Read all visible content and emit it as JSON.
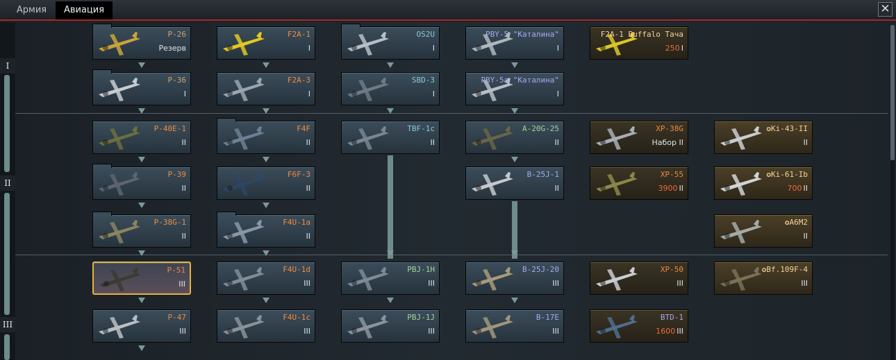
{
  "tabs": {
    "army": "Армия",
    "aviation": "Авиация"
  },
  "close_label": "✕",
  "ranks": [
    "I",
    "II",
    "III"
  ],
  "vehicles": [
    {
      "id": "p26",
      "name": "P-26",
      "stat": "Резерв",
      "cls": "sq"
    },
    {
      "id": "p36",
      "name": "P-36",
      "stat": "I",
      "cls": "sq"
    },
    {
      "id": "p40e1",
      "name": "P-40E-1",
      "stat": "II",
      "cls": "org"
    },
    {
      "id": "p39",
      "name": "P-39",
      "stat": "II",
      "cls": "org"
    },
    {
      "id": "p38g1",
      "name": "P-38G-1",
      "stat": "II",
      "cls": "org"
    },
    {
      "id": "p51",
      "name": "P-51",
      "stat": "III",
      "cls": "org"
    },
    {
      "id": "p47",
      "name": "P-47",
      "stat": "III",
      "cls": "org"
    },
    {
      "id": "f2a1",
      "name": "F2A-1",
      "stat": "I",
      "cls": "org"
    },
    {
      "id": "f2a3",
      "name": "F2A-3",
      "stat": "I",
      "cls": "org"
    },
    {
      "id": "f4f",
      "name": "F4F",
      "stat": "II",
      "cls": "org"
    },
    {
      "id": "f6f3",
      "name": "F6F-3",
      "stat": "II",
      "cls": "org"
    },
    {
      "id": "f4u1a",
      "name": "F4U-1a",
      "stat": "II",
      "cls": "org"
    },
    {
      "id": "f4u1d",
      "name": "F4U-1d",
      "stat": "III",
      "cls": "org"
    },
    {
      "id": "f4u1c",
      "name": "F4U-1c",
      "stat": "III",
      "cls": "org"
    },
    {
      "id": "os2u",
      "name": "OS2U",
      "stat": "I",
      "cls": "blu"
    },
    {
      "id": "sbd3",
      "name": "SBD-3",
      "stat": "I",
      "cls": "blu"
    },
    {
      "id": "tbf1c",
      "name": "TBF-1c",
      "stat": "II",
      "cls": "blu"
    },
    {
      "id": "pbj1h",
      "name": "PBJ-1H",
      "stat": "III",
      "cls": "grn"
    },
    {
      "id": "pbj1j",
      "name": "PBJ-1J",
      "stat": "III",
      "cls": "grn"
    },
    {
      "id": "pby5",
      "name": "PBY-5 \"Каталина\"",
      "stat": "I",
      "cls": "pur"
    },
    {
      "id": "pby5a",
      "name": "PBY-5a \"Каталина\"",
      "stat": "I",
      "cls": "pur"
    },
    {
      "id": "a20g25",
      "name": "A-20G-25",
      "stat": "II",
      "cls": "grn"
    },
    {
      "id": "b25j1",
      "name": "B-25J-1",
      "stat": "II",
      "cls": "pur"
    },
    {
      "id": "b25j20",
      "name": "B-25J-20",
      "stat": "III",
      "cls": "pur"
    },
    {
      "id": "b17e",
      "name": "B-17E",
      "stat": "III",
      "cls": "pur"
    },
    {
      "id": "f2a1buf",
      "name": "F2A-1 Buffalo Тача",
      "price": "250",
      "stat": "I",
      "cls": "gold"
    },
    {
      "id": "xp38g",
      "name": "XP-38G",
      "stat": "Набор II",
      "cls": "org"
    },
    {
      "id": "xp55",
      "name": "XP-55",
      "price": "3900",
      "stat": "II",
      "cls": "org"
    },
    {
      "id": "xp50",
      "name": "XP-50",
      "stat": "III",
      "cls": "org"
    },
    {
      "id": "btd1",
      "name": "BTD-1",
      "price": "1600",
      "stat": "III",
      "cls": "pur"
    },
    {
      "id": "ki43",
      "name": "✪Ki-43-II",
      "stat": "II",
      "cls": "gold"
    },
    {
      "id": "ki61",
      "name": "✪Ki-61-Ib",
      "price": "700",
      "stat": "II",
      "cls": "gold"
    },
    {
      "id": "a6m2",
      "name": "✪A6M2",
      "stat": "II",
      "cls": "gold"
    },
    {
      "id": "bf109",
      "name": "✪Bf.109F-4",
      "stat": "III",
      "cls": "gold"
    }
  ],
  "colors": {
    "accent_line": "#a32828",
    "selected_border": "#e7b33d",
    "premium_price": "#f26a3a"
  }
}
